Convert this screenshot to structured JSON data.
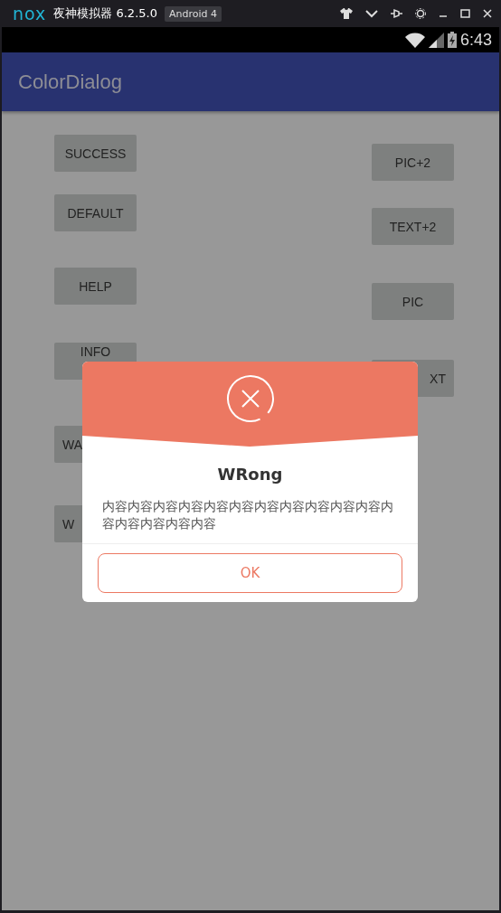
{
  "emulator": {
    "brand": "nox",
    "title": "夜神模拟器 6.2.5.0",
    "badge": "Android 4"
  },
  "status_bar": {
    "time": "6:43"
  },
  "app_bar": {
    "title": "ColorDialog"
  },
  "left_buttons": [
    {
      "label": "SUCCESS",
      "kind": "full"
    },
    {
      "label": "DEFAULT",
      "kind": "full"
    },
    {
      "label": "HELP",
      "kind": "full"
    },
    {
      "label": "INFO",
      "kind": "cut-bottom"
    },
    {
      "label": "WA",
      "kind": "cut-left"
    },
    {
      "label": "W",
      "kind": "cut-left"
    }
  ],
  "right_buttons": [
    {
      "label": "PIC+2",
      "kind": "full"
    },
    {
      "label": "TEXT+2",
      "kind": "full"
    },
    {
      "label": "PIC",
      "kind": "full"
    },
    {
      "label": "XT",
      "kind": "cut-right"
    }
  ],
  "dialog": {
    "title": "WRong",
    "message": "内容内容内容内容内容内容内容内容内容内容内容内容内容内容内容内容",
    "button": "OK"
  }
}
